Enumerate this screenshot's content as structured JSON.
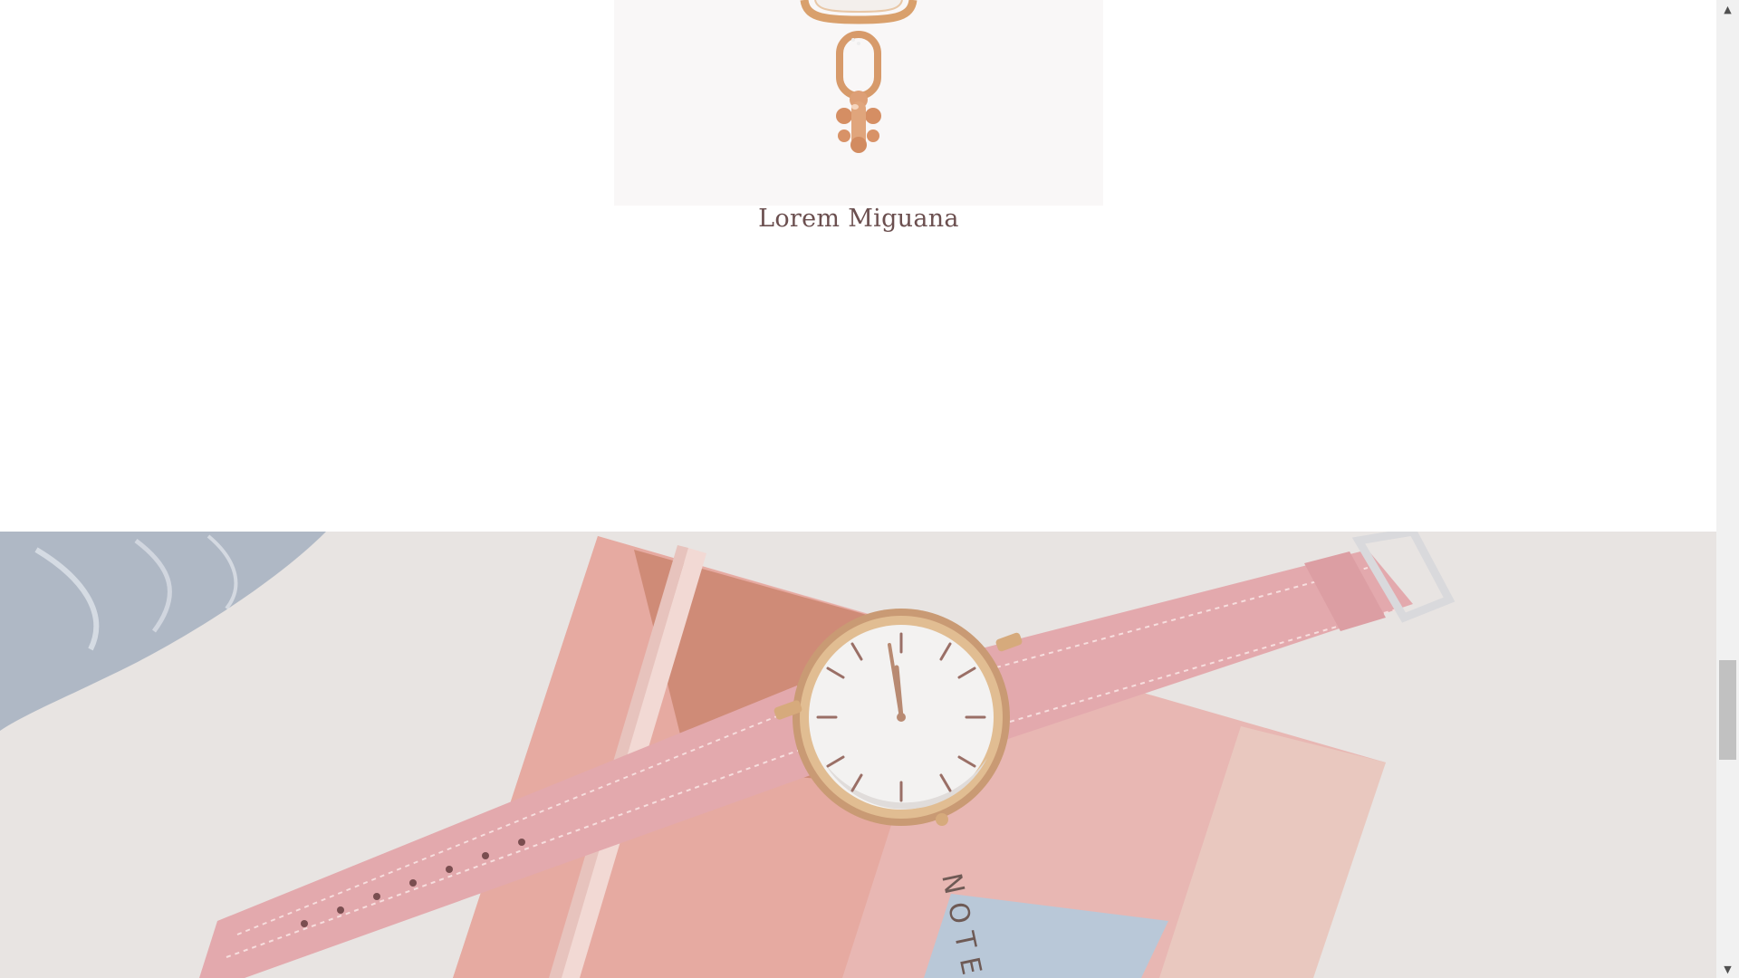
{
  "product": {
    "title": "Lorem Miguana",
    "image_alt": "rose gold chain pendant"
  },
  "hero": {
    "image_alt": "pink watch on notebook",
    "notebook_text": "NOTES"
  },
  "scrollbar": {
    "up_icon": "▲",
    "down_icon": "▼"
  },
  "colors": {
    "title": "#6b4f4f",
    "strap": "#e3a9ad",
    "gold": "#d9a06c",
    "background": "#e9e5e3"
  }
}
